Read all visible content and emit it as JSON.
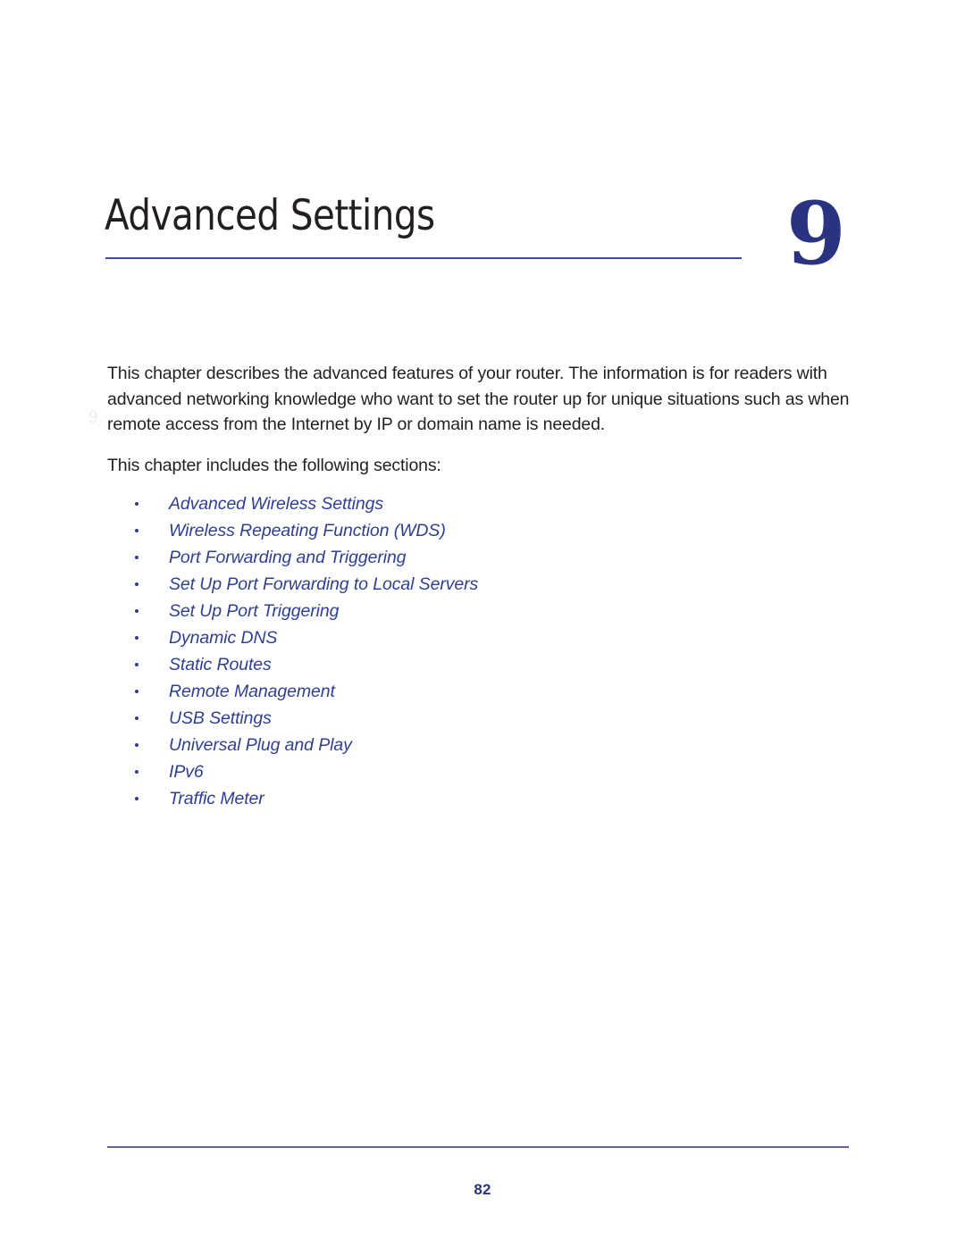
{
  "chapter": {
    "title": "Advanced Settings",
    "number": "9",
    "ghost_marker": "9."
  },
  "body": {
    "intro_paragraph": "This chapter describes the advanced features of your router. The information is for readers with advanced networking knowledge who want to set the router up for unique situations such as when remote access from the Internet by IP or domain name is needed.",
    "sections_lead": "This chapter includes the following sections:"
  },
  "sections": [
    {
      "label": "Advanced Wireless Settings"
    },
    {
      "label": "Wireless Repeating Function (WDS)"
    },
    {
      "label": "Port Forwarding and Triggering"
    },
    {
      "label": "Set Up Port Forwarding to Local Servers"
    },
    {
      "label": "Set Up Port Triggering"
    },
    {
      "label": "Dynamic DNS"
    },
    {
      "label": "Static Routes"
    },
    {
      "label": "Remote Management"
    },
    {
      "label": "USB Settings"
    },
    {
      "label": "Universal Plug and Play"
    },
    {
      "label": "IPv6"
    },
    {
      "label": "Traffic Meter"
    }
  ],
  "footer": {
    "page_number": "82"
  },
  "colors": {
    "accent_blue": "#2e3f94",
    "chapter_number_blue": "#2a3382",
    "rule_blue": "#414a9b",
    "footer_rule_blue": "#5b62b8",
    "body_text": "#231f20"
  }
}
